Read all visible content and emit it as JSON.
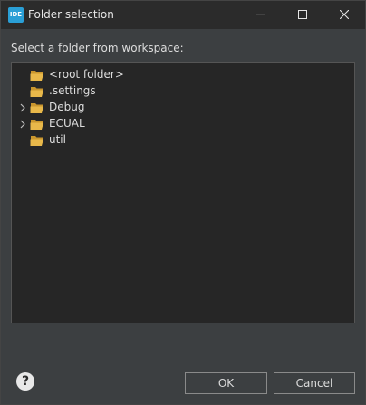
{
  "window": {
    "title": "Folder selection",
    "app_icon_text": "IDE"
  },
  "dialog": {
    "prompt": "Select a folder from workspace:",
    "tree": [
      {
        "label": "<root folder>",
        "expandable": false
      },
      {
        "label": ".settings",
        "expandable": false
      },
      {
        "label": "Debug",
        "expandable": true
      },
      {
        "label": "ECUAL",
        "expandable": true
      },
      {
        "label": "util",
        "expandable": false
      }
    ],
    "help_label": "?",
    "ok_label": "OK",
    "cancel_label": "Cancel"
  },
  "colors": {
    "folder": "#e8b84a",
    "tree_bg": "#262626",
    "dialog_bg": "#3c3f41"
  }
}
